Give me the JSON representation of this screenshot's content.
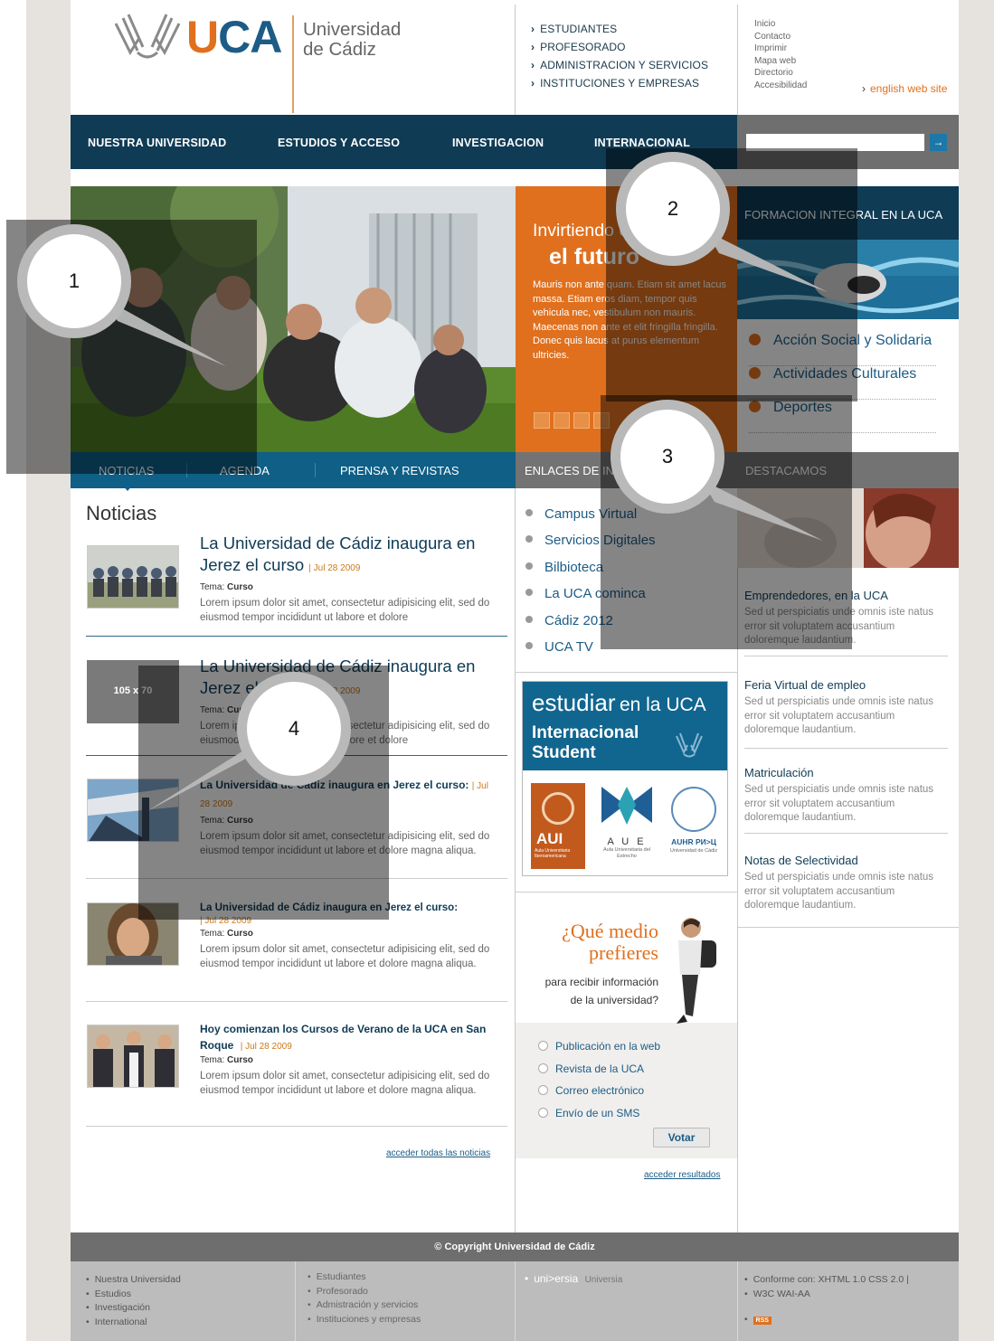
{
  "brand": {
    "logo_text": "UCA",
    "name_line1": "Universidad",
    "name_line2": "de Cádiz"
  },
  "audience_links": [
    "ESTUDIANTES",
    "PROFESORADO",
    "ADMINISTRACION Y SERVICIOS",
    "INSTITUCIONES Y EMPRESAS"
  ],
  "utility_links": [
    "Inicio",
    "Contacto",
    "Imprimir",
    "Mapa web",
    "Directorio",
    "Accesibilidad"
  ],
  "english_link": "english web site",
  "nav": [
    "NUESTRA  UNIVERSIDAD",
    "ESTUDIOS  Y ACCESO",
    "INVESTIGACION",
    "INTERNACIONAL"
  ],
  "search": {
    "button": "→"
  },
  "hero": {
    "title_line1": "Invirtiendo en",
    "title_line2": "el futuro",
    "body": "Mauris non ante quam. Etiam sit amet lacus massa. Etiam eros diam, tempor quis vehicula nec, vestibulum non mauris. Maecenas non ante et elit fringilla fringilla. Donec quis lacus at purus elementum ultricies."
  },
  "formacion": {
    "title": "FORMACION INTEGRAL EN LA UCA",
    "items": [
      "Acción Social y Solidaria",
      "Actividades Culturales",
      "Deportes"
    ]
  },
  "tabs": {
    "noticias": "NOTICIAS",
    "agenda": "AGENDA",
    "prensa": "PRENSA Y REVISTAS",
    "enlaces": "ENLACES DE IN",
    "destacamos": "DESTACAMOS"
  },
  "news": {
    "heading": "Noticias",
    "items": [
      {
        "title": "La Universidad de Cádiz inaugura en Jerez el curso",
        "date": "| Jul 28 2009",
        "tema_label": "Tema:",
        "tema": "Curso",
        "body": "Lorem ipsum dolor sit amet, consectetur adipisicing elit, sed do eiusmod tempor incididunt ut labore et dolore"
      },
      {
        "title": "La Universidad de Cádiz inaugura en Jerez el curso",
        "date": "| Jul 28 2009",
        "tema_label": "Tema:",
        "tema": "Curso",
        "body": "Lorem ipsum dolor sit amet, consectetur adipisicing elit, sed do eiusmod tempor incididunt ut labore et dolore",
        "thumb": "105 x 70"
      },
      {
        "title": "La Universidad de Cádiz inaugura en Jerez el curso:",
        "date": "| Jul 28 2009",
        "tema_label": "Tema:",
        "tema": "Curso",
        "body": "Lorem ipsum dolor sit amet, consectetur adipisicing elit, sed do eiusmod tempor incididunt ut labore et dolore magna aliqua."
      },
      {
        "title": "La Universidad de Cádiz inaugura en Jerez el curso:",
        "date": "| Jul 28 2009",
        "tema_label": "Tema:",
        "tema": "Curso",
        "body": "Lorem ipsum dolor sit amet, consectetur adipisicing elit, sed do eiusmod tempor incididunt ut labore et dolore magna aliqua."
      },
      {
        "title": "Hoy comienzan los Cursos de Verano de la UCA en San Roque",
        "date": "| Jul 28 2009",
        "tema_label": "Tema:",
        "tema": "Curso",
        "body": "Lorem ipsum dolor sit amet, consectetur adipisicing elit, sed do eiusmod tempor incididunt ut labore et dolore magna aliqua."
      }
    ],
    "all_link": "acceder todas las noticias"
  },
  "enlaces": [
    "Campus Virtual",
    "Servicios Digitales",
    "Bilbioteca",
    "La UCA cominca",
    "Cádiz 2012",
    "UCA TV"
  ],
  "estudiar": {
    "line1": "estudiar",
    "line1b": "en la UCA",
    "line2": "Internacional",
    "line3": "Student",
    "logos": [
      "AUI",
      "A U E",
      "AUHR PИ>Ц"
    ],
    "logo_subs": [
      "Aula Universitaria Iberoamericana",
      "Aula Universitaria del Estrecho",
      "Universidad de Cádiz"
    ]
  },
  "poll": {
    "q1": "¿Qué medio",
    "q2": "prefieres",
    "q3": "para recibir información",
    "q4": "de la universidad?",
    "options": [
      "Publicación en la web",
      "Revista de la UCA",
      "Correo electrónico",
      "Envío de un SMS"
    ],
    "vote": "Votar",
    "results": "acceder resultados"
  },
  "destacamos": [
    {
      "title": "Emprendedores, en la UCA",
      "body": "Sed ut perspiciatis unde omnis iste natus error sit voluptatem accusantium doloremque laudantium."
    },
    {
      "title": "Feria Virtual de empleo",
      "body": "Sed ut perspiciatis unde omnis iste natus error sit voluptatem accusantium doloremque laudantium."
    },
    {
      "title": "Matriculación",
      "body": "Sed ut perspiciatis unde omnis iste natus error sit voluptatem accusantium doloremque laudantium."
    },
    {
      "title": "Notas de Selectividad",
      "body": "Sed ut perspiciatis unde omnis iste natus error sit voluptatem accusantium doloremque laudantium."
    }
  ],
  "footer": {
    "copyright": "© Copyright Universidad de Cádiz",
    "col1": [
      "Nuestra Universidad",
      "Estudios",
      "Investigación",
      "International"
    ],
    "col2": [
      "Estudiantes",
      "Profesorado",
      "Admistración y servicios",
      "Instituciones y empresas"
    ],
    "universia1": "uni>ersia",
    "universia2": "Universia",
    "col4": [
      "Conforme con: XHTML 1.0  CSS 2.0 |",
      "W3C  WAI-AA"
    ],
    "rss": "RSS"
  },
  "callouts": [
    "1",
    "2",
    "3",
    "4"
  ]
}
